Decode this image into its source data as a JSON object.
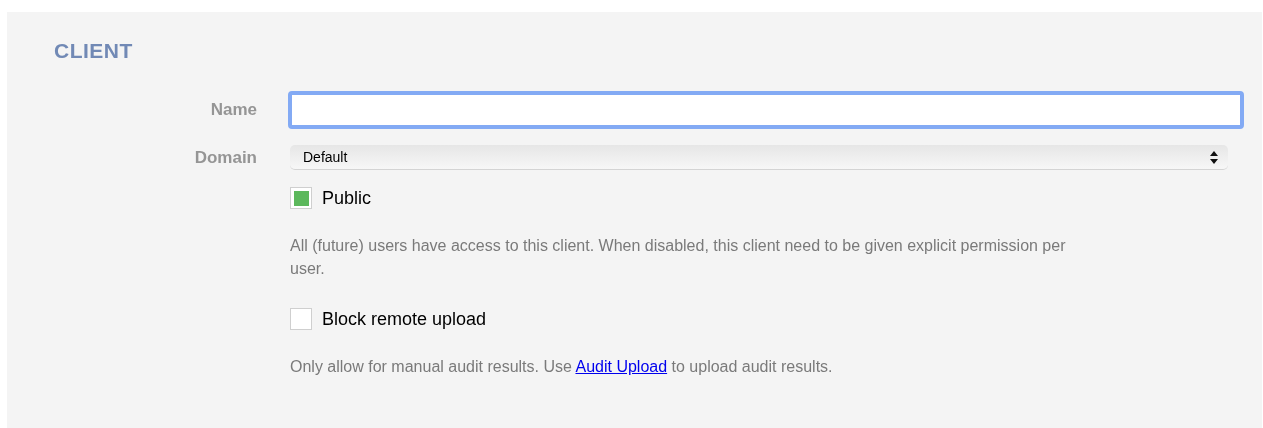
{
  "section": {
    "title": "CLIENT"
  },
  "fields": [
    {
      "kind": "text",
      "label": "Name",
      "focused": true
    },
    {
      "kind": "select",
      "label": "Domain",
      "value": "Default"
    }
  ],
  "options": [
    {
      "label": "Public",
      "checked": true,
      "help": [
        {
          "text": "All (future) users have access to this client. When disabled, this client need to be given explicit permission per user."
        }
      ]
    },
    {
      "label": "Block remote upload",
      "checked": false,
      "help": [
        {
          "text": "Only allow for manual audit results. Use "
        },
        {
          "text": "Audit Upload",
          "link": true
        },
        {
          "text": " to upload audit results."
        }
      ]
    }
  ]
}
